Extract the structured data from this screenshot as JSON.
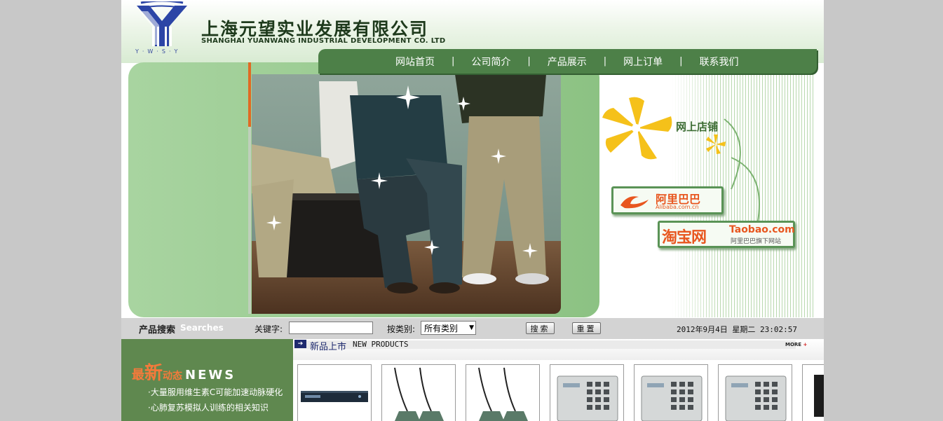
{
  "header": {
    "company_cn": "上海元望实业发展有限公司",
    "company_en": "SHANGHAI YUANWANG INDUSTRIAL DEVELOPMENT CO. LTD",
    "logo_sub": "Y·W·S·Y"
  },
  "nav": {
    "items": [
      "网站首页",
      "公司简介",
      "产品展示",
      "网上订单",
      "联系我们"
    ],
    "separator": "|"
  },
  "shops": {
    "title": "网上店铺",
    "alibaba_cn": "阿里巴巴",
    "alibaba_en": "Alibaba.com.cn",
    "taobao_cn": "淘宝网",
    "taobao_en": "Taobao.com",
    "taobao_sub": "阿里巴巴旗下网站"
  },
  "search": {
    "title": "产品搜索",
    "title_en": "Searches",
    "keyword_label": "关键字:",
    "keyword_value": "",
    "category_label": "按类别:",
    "category_selected": "所有类别",
    "search_button": "搜索",
    "reset_button": "重置",
    "datetime": "2012年9月4日 星期二 23:02:57"
  },
  "news": {
    "title_1": "最",
    "title_2": "新",
    "title_3": "动态",
    "title_en": "NEWS",
    "items": [
      "·大量服用维生素C可能加速动脉硬化",
      "·心肺复苏模拟人训练的相关知识"
    ]
  },
  "new_products": {
    "title_cn": "新品上市",
    "title_en": "NEW PRODUCTS",
    "more": "MORE",
    "more_plus": "+",
    "items": [
      {
        "icon": "rack-unit-icon"
      },
      {
        "icon": "conference-microphone-icon"
      },
      {
        "icon": "conference-microphone-icon"
      },
      {
        "icon": "keypad-panel-icon"
      },
      {
        "icon": "keypad-panel-icon"
      },
      {
        "icon": "keypad-panel-icon"
      },
      {
        "icon": "device-panel-icon"
      }
    ]
  },
  "colors": {
    "nav_bg": "#4d8048",
    "banner_green": "#9ccd93",
    "news_bg": "#5f884f",
    "accent_orange": "#f47a3b",
    "shop_orange": "#e8561f"
  }
}
